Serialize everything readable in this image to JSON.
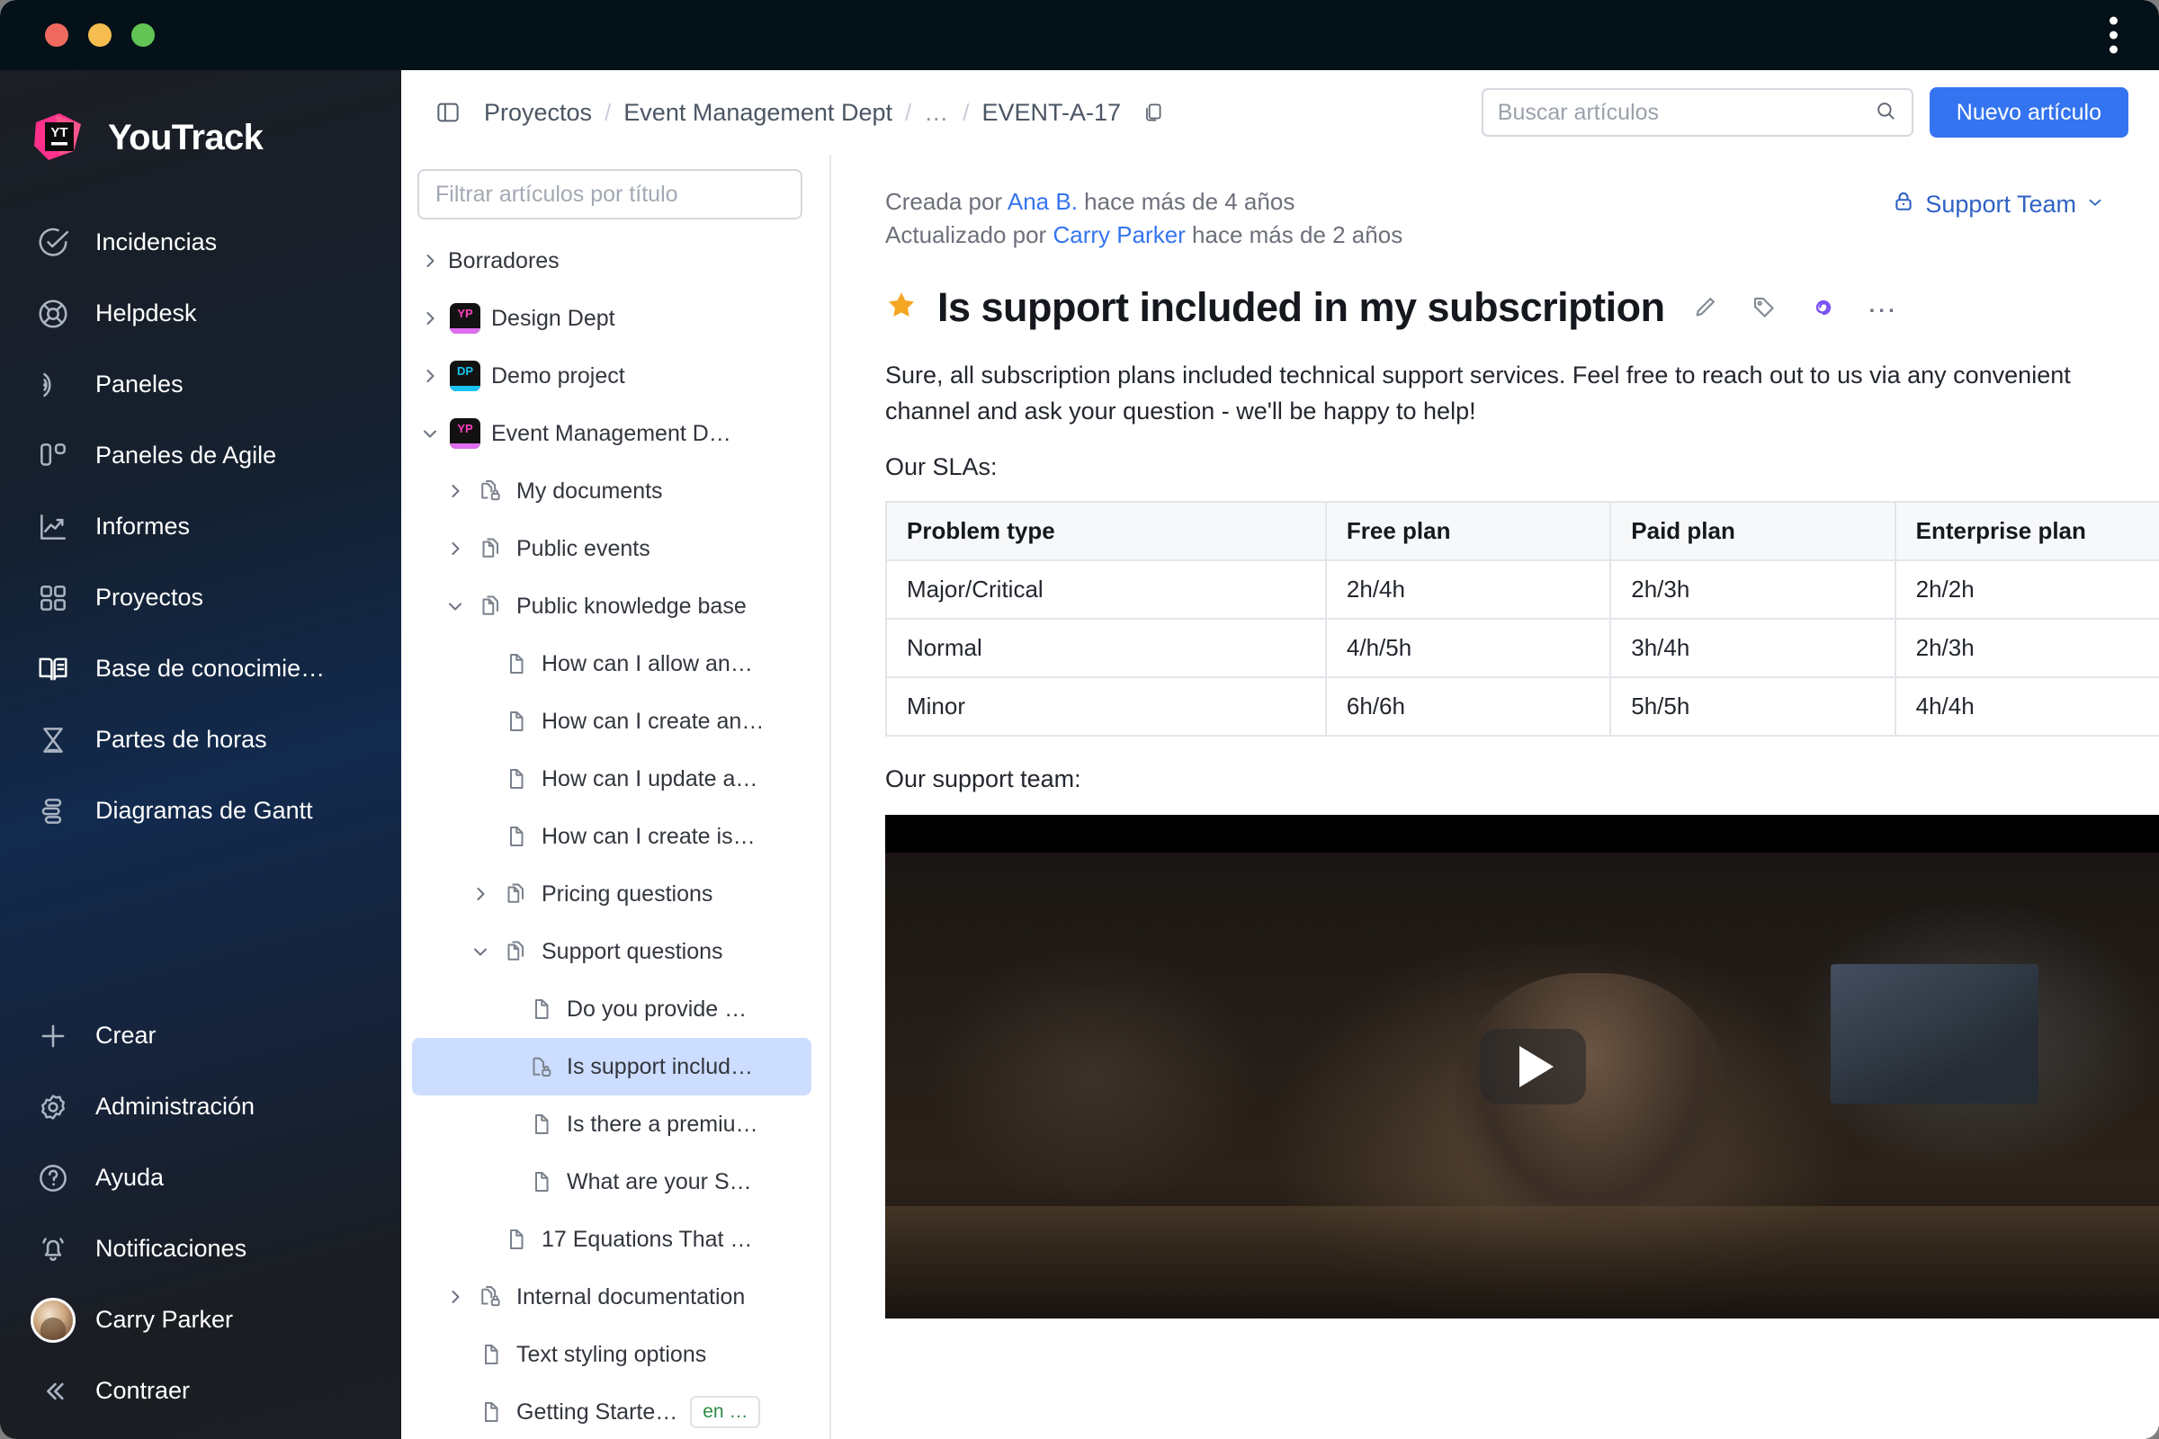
{
  "window": {
    "traffic_lights": [
      "close",
      "minimize",
      "zoom"
    ],
    "menu_icon": "kebab-menu-icon"
  },
  "brand": {
    "name": "YouTrack",
    "logo": "youtrack-logo"
  },
  "sidebar": {
    "items": [
      {
        "label": "Incidencias",
        "icon": "check-circle-icon"
      },
      {
        "label": "Helpdesk",
        "icon": "lifebuoy-icon"
      },
      {
        "label": "Paneles",
        "icon": "dashboard-icon"
      },
      {
        "label": "Paneles de Agile",
        "icon": "agile-board-icon"
      },
      {
        "label": "Informes",
        "icon": "chart-up-icon"
      },
      {
        "label": "Proyectos",
        "icon": "grid-icon"
      },
      {
        "label": "Base de conocimie…",
        "icon": "open-book-icon"
      },
      {
        "label": "Partes de horas",
        "icon": "hourglass-icon"
      },
      {
        "label": "Diagramas de Gantt",
        "icon": "gantt-icon"
      }
    ],
    "bottom_items": [
      {
        "label": "Crear",
        "icon": "plus-icon"
      },
      {
        "label": "Administración",
        "icon": "gear-icon"
      },
      {
        "label": "Ayuda",
        "icon": "question-circle-icon"
      },
      {
        "label": "Notificaciones",
        "icon": "bell-icon"
      }
    ],
    "user": {
      "name": "Carry Parker",
      "avatar": "user-avatar"
    },
    "collapse": {
      "label": "Contraer",
      "icon": "chevrons-left-icon"
    }
  },
  "topbar": {
    "sidebar_toggle_icon": "panel-toggle-icon",
    "breadcrumbs": [
      {
        "label": "Proyectos"
      },
      {
        "label": "Event Management Dept"
      },
      {
        "label": "…"
      },
      {
        "label": "EVENT-A-17"
      }
    ],
    "copy_icon": "copy-icon",
    "search": {
      "placeholder": "Buscar artículos",
      "value": "",
      "icon": "search-icon"
    },
    "new_article_label": "Nuevo artículo"
  },
  "tree": {
    "filter": {
      "placeholder": "Filtrar artículos por título",
      "value": ""
    },
    "items": [
      {
        "label": "Borradores",
        "indent": 0,
        "twist": "collapsed",
        "icon": "none"
      },
      {
        "label": "Design Dept",
        "indent": 0,
        "twist": "collapsed",
        "icon": "project-badge",
        "badge": "YP",
        "badge_color": "pink"
      },
      {
        "label": "Demo project",
        "indent": 0,
        "twist": "collapsed",
        "icon": "project-badge",
        "badge": "DP",
        "badge_color": "cyan"
      },
      {
        "label": "Event Management D…",
        "indent": 0,
        "twist": "expanded",
        "icon": "project-badge",
        "badge": "YP",
        "badge_color": "pink"
      },
      {
        "label": "My documents",
        "indent": 1,
        "twist": "collapsed",
        "icon": "pages-lock-icon"
      },
      {
        "label": "Public events",
        "indent": 1,
        "twist": "collapsed",
        "icon": "pages-icon"
      },
      {
        "label": "Public knowledge base",
        "indent": 1,
        "twist": "expanded",
        "icon": "pages-icon"
      },
      {
        "label": "How can I allow an…",
        "indent": 2,
        "twist": "none",
        "icon": "page-icon"
      },
      {
        "label": "How can I create an…",
        "indent": 2,
        "twist": "none",
        "icon": "page-icon"
      },
      {
        "label": "How can I update a…",
        "indent": 2,
        "twist": "none",
        "icon": "page-icon"
      },
      {
        "label": "How can I create is…",
        "indent": 2,
        "twist": "none",
        "icon": "page-icon"
      },
      {
        "label": "Pricing questions",
        "indent": 2,
        "twist": "collapsed",
        "icon": "pages-icon"
      },
      {
        "label": "Support questions",
        "indent": 2,
        "twist": "expanded",
        "icon": "pages-icon"
      },
      {
        "label": "Do you provide …",
        "indent": 3,
        "twist": "none",
        "icon": "page-icon"
      },
      {
        "label": "Is support includ…",
        "indent": 3,
        "twist": "none",
        "icon": "page-lock-icon",
        "selected": true
      },
      {
        "label": "Is there a premiu…",
        "indent": 3,
        "twist": "none",
        "icon": "page-icon"
      },
      {
        "label": "What are your S…",
        "indent": 3,
        "twist": "none",
        "icon": "page-icon"
      },
      {
        "label": "17 Equations That …",
        "indent": 2,
        "twist": "none",
        "icon": "page-icon"
      },
      {
        "label": "Internal documentation",
        "indent": 1,
        "twist": "collapsed",
        "icon": "pages-lock-icon"
      },
      {
        "label": "Text styling options",
        "indent": 1,
        "twist": "none",
        "icon": "page-icon"
      },
      {
        "label": "Getting Starte…",
        "indent": 1,
        "twist": "none",
        "icon": "page-icon",
        "lang_badge": "en …"
      }
    ]
  },
  "article": {
    "created_prefix": "Creada por ",
    "created_author": "Ana B.",
    "created_suffix": " hace más de 4 años",
    "updated_prefix": "Actualizado por ",
    "updated_author": "Carry Parker",
    "updated_suffix": " hace más de 2 años",
    "visibility": {
      "label": "Support Team",
      "icon": "lock-icon",
      "chevron": "chevron-down-icon"
    },
    "star_icon": "star-filled-icon",
    "title": "Is support included in my subscription",
    "actions": [
      {
        "name": "edit-icon"
      },
      {
        "name": "tag-icon"
      },
      {
        "name": "ai-spiral-icon"
      },
      {
        "name": "more-icon",
        "label": "…"
      }
    ],
    "paragraph": "Sure, all subscription plans included technical support services. Feel free to reach out to us via any convenient channel and ask your question - we'll be happy to help!",
    "sla_label": "Our SLAs:",
    "sla_table": {
      "headers": [
        "Problem type",
        "Free plan",
        "Paid plan",
        "Enterprise plan"
      ],
      "rows": [
        [
          "Major/Critical",
          "2h/4h",
          "2h/3h",
          "2h/2h"
        ],
        [
          "Normal",
          "4/h/5h",
          "3h/4h",
          "2h/3h"
        ],
        [
          "Minor",
          "6h/6h",
          "5h/5h",
          "4h/4h"
        ]
      ]
    },
    "support_label": "Our support team:",
    "video": {
      "play_icon": "play-button-icon"
    }
  },
  "colors": {
    "accent_blue": "#3574f0",
    "nav_dark": "#1b1e23",
    "selected_tree": "#ccddff",
    "star_orange": "#f5a623",
    "ai_purple": "#7a52f4",
    "lang_green": "#2f8a45"
  }
}
